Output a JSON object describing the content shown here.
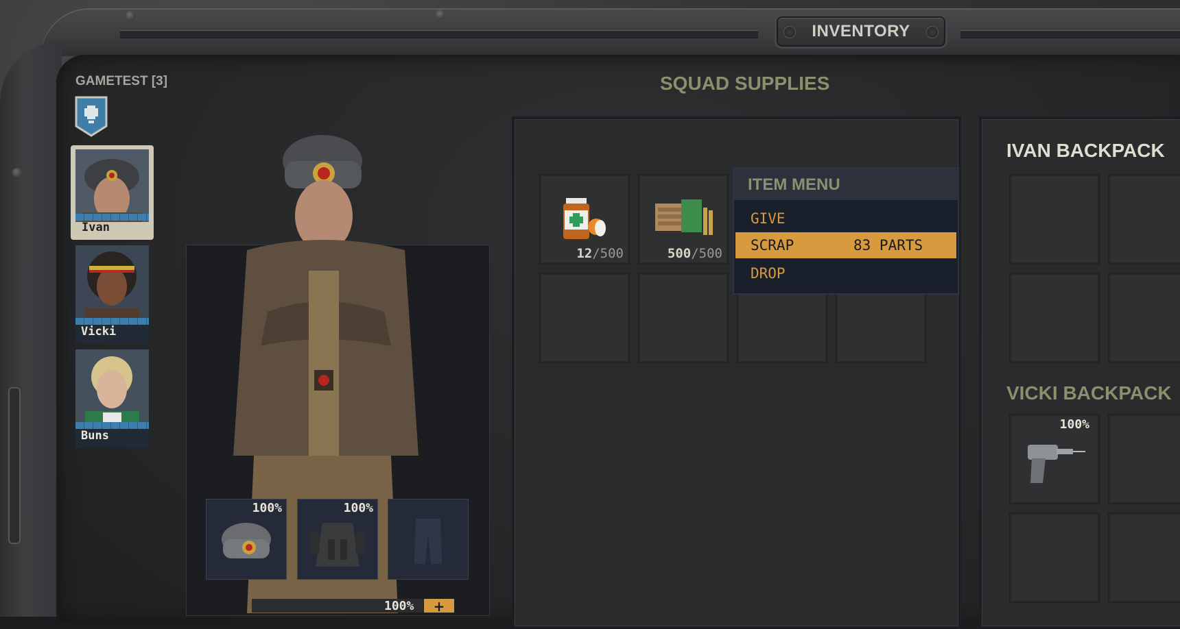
{
  "window": {
    "tab_label": "INVENTORY"
  },
  "squad": {
    "label": "GAMETEST [3]"
  },
  "characters": [
    {
      "name": "Ivan",
      "selected": true
    },
    {
      "name": "Vicki",
      "selected": false
    },
    {
      "name": "Buns",
      "selected": false
    }
  ],
  "equipment": [
    {
      "item": "ushanka-hat-icon",
      "condition": "100%"
    },
    {
      "item": "armor-vest-icon",
      "condition": "100%"
    },
    {
      "item": "pants-icon",
      "condition": ""
    }
  ],
  "weapon_bar": {
    "condition": "100%",
    "button": "+"
  },
  "supplies": {
    "title": "SQUAD SUPPLIES",
    "items": [
      {
        "icon": "medicine-bottle-icon",
        "qty": "12",
        "max": "/500"
      },
      {
        "icon": "ammo-box-icon",
        "qty": "500",
        "max": "/500"
      }
    ]
  },
  "item_menu": {
    "header": "ITEM MENU",
    "options": [
      {
        "label": "GIVE",
        "active": false
      },
      {
        "label": "SCRAP",
        "detail": "83 PARTS",
        "active": true
      },
      {
        "label": "DROP",
        "active": false
      }
    ]
  },
  "backpacks": {
    "ivan": {
      "title": "IVAN BACKPACK"
    },
    "vicki": {
      "title": "VICKI BACKPACK",
      "items": [
        {
          "icon": "drill-gun-icon",
          "condition": "100%"
        }
      ]
    }
  },
  "colors": {
    "accent": "#d89a3e",
    "title_olive": "#8c8e6e",
    "portrait_bar": "#3c7fae"
  }
}
